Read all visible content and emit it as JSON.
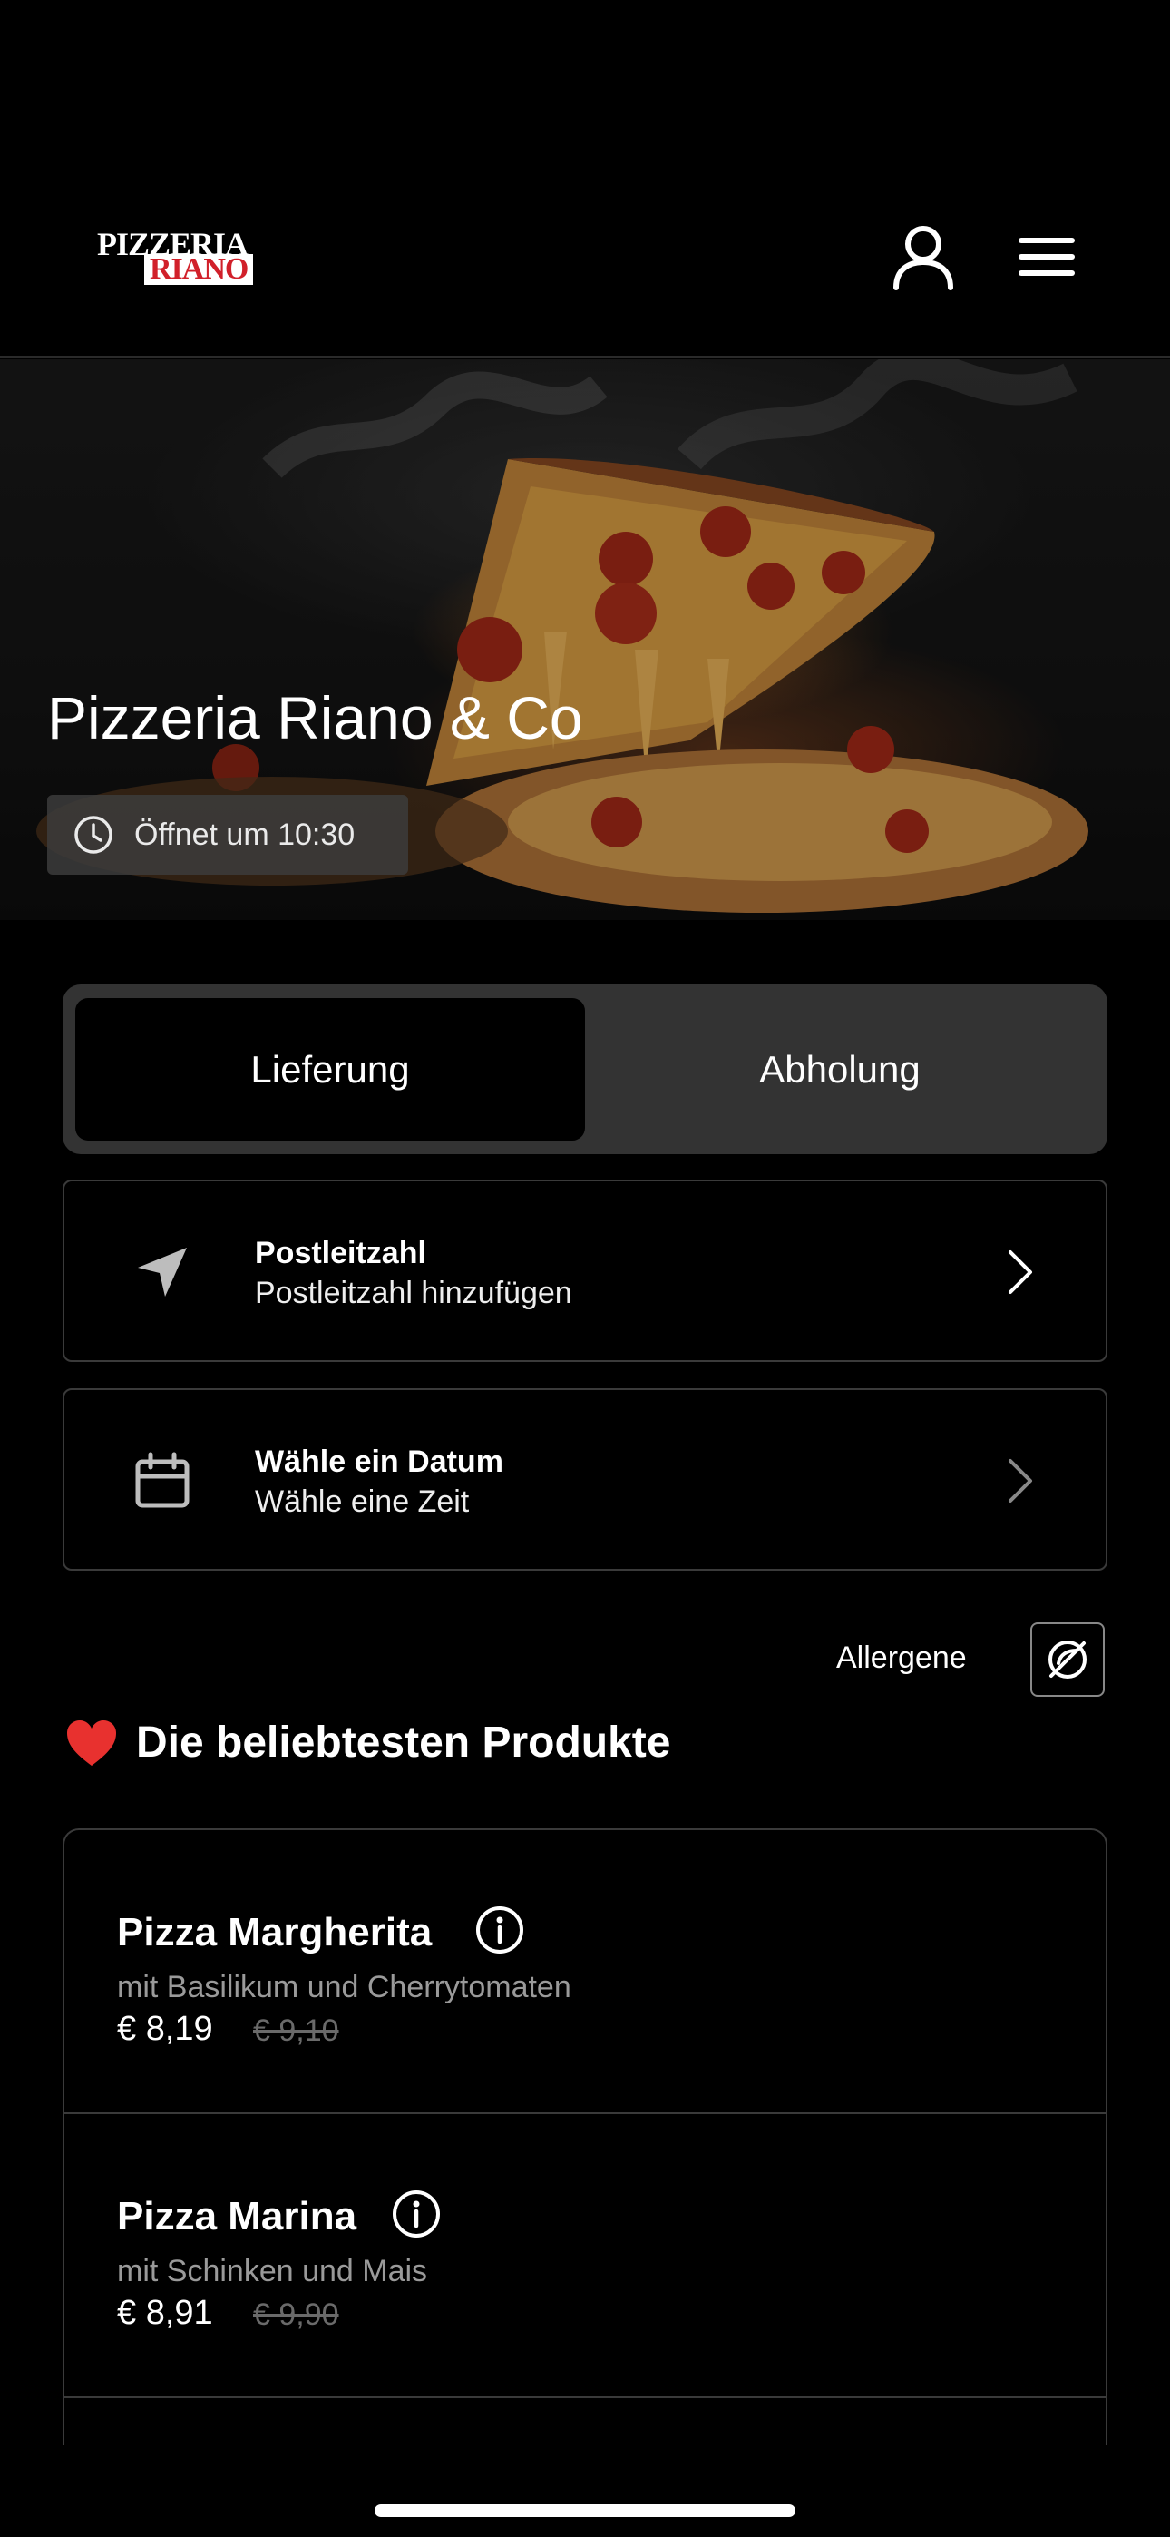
{
  "header": {
    "logo_line1": "PIZZERIA",
    "logo_line2": "RIANO",
    "account_icon": "user-icon",
    "menu_icon": "hamburger-menu-icon"
  },
  "hero": {
    "title": "Pizzeria Riano & Co",
    "opening_text": "Öffnet um 10:30",
    "clock_icon": "clock-icon"
  },
  "order_mode": {
    "options": [
      "Lieferung",
      "Abholung"
    ],
    "selected": "Lieferung"
  },
  "postal_card": {
    "title": "Postleitzahl",
    "subtitle": "Postleitzahl hinzufügen",
    "icon": "location-arrow-icon"
  },
  "date_card": {
    "title": "Wähle ein Datum",
    "subtitle": "Wähle eine Zeit",
    "icon": "calendar-icon"
  },
  "allergens": {
    "label": "Allergene",
    "icon": "allergen-filter-icon"
  },
  "section": {
    "title": "Die beliebtesten Produkte",
    "icon": "heart-icon"
  },
  "products": [
    {
      "name": "Pizza Margherita",
      "description": "mit Basilikum und Cherrytomaten",
      "price": "€ 8,19",
      "old_price": "€ 9,10"
    },
    {
      "name": "Pizza Marina",
      "description": "mit Schinken und Mais",
      "price": "€ 8,91",
      "old_price": "€ 9,90"
    }
  ],
  "colors": {
    "background": "#000000",
    "segment_bg": "#333333",
    "border": "#3a3a3a",
    "logo_red": "#d1202a",
    "muted_text": "#9a9a9a"
  }
}
